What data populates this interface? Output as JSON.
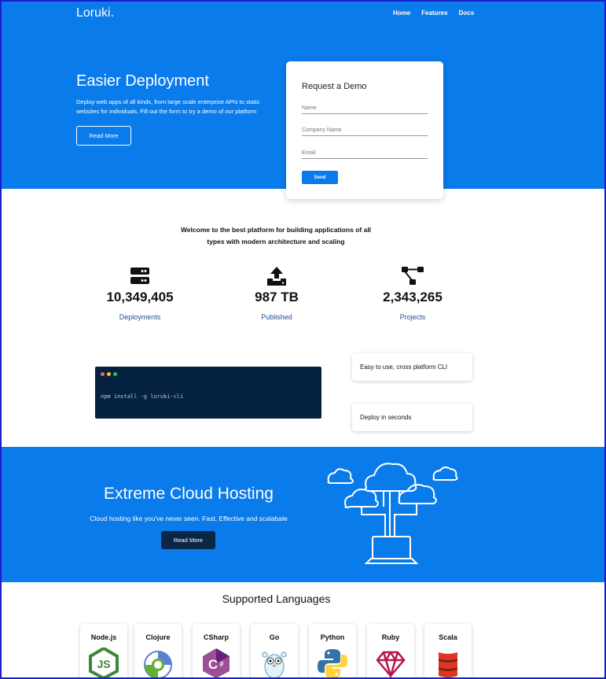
{
  "brand": {
    "name": "Loruki."
  },
  "nav": {
    "items": [
      "Home",
      "Features",
      "Docs"
    ]
  },
  "hero": {
    "title": "Easier Deployment",
    "description": "Deploy web apps of all kinds, from large scale enterprise APIs to static websites for individuals. Fill out the form to try a demo of our platform",
    "button": "Read More"
  },
  "demo_form": {
    "title": "Request a Demo",
    "name_placeholder": "Name",
    "company_placeholder": "Company Name",
    "email_placeholder": "Email",
    "submit": "Send"
  },
  "welcome": {
    "text": "Welcome to the best platform for building applications of all types with modern architecture and scaling"
  },
  "stats": [
    {
      "icon": "server-icon",
      "value": "10,349,405",
      "label": "Deployments"
    },
    {
      "icon": "upload-icon",
      "value": "987 TB",
      "label": "Published"
    },
    {
      "icon": "project-diagram-icon",
      "value": "2,343,265",
      "label": "Projects"
    }
  ],
  "terminal": {
    "command": "npm install -g loruki-cli",
    "dot_colors": [
      "#ff5f56",
      "#ffbd2e",
      "#27c93f"
    ]
  },
  "features": [
    {
      "text": "Easy to use, cross platform CLI"
    },
    {
      "text": "Deploy in seconds"
    }
  ],
  "cloud": {
    "title": "Extreme Cloud Hosting",
    "description": "Cloud hosting like you've never seen. Fast, Effective and scalabale",
    "button": "Read More"
  },
  "languages": {
    "title": "Supported Languages",
    "items": [
      {
        "name": "Node.js",
        "icon": "nodejs-icon"
      },
      {
        "name": "Clojure",
        "icon": "clojure-icon"
      },
      {
        "name": "CSharp",
        "icon": "csharp-icon"
      },
      {
        "name": "Go",
        "icon": "go-icon"
      },
      {
        "name": "Python",
        "icon": "python-icon"
      },
      {
        "name": "Ruby",
        "icon": "ruby-icon"
      },
      {
        "name": "Scala",
        "icon": "scala-icon"
      }
    ]
  },
  "colors": {
    "primary": "#0a7bea",
    "dark": "#0b2748",
    "terminal_bg": "#04223f"
  }
}
